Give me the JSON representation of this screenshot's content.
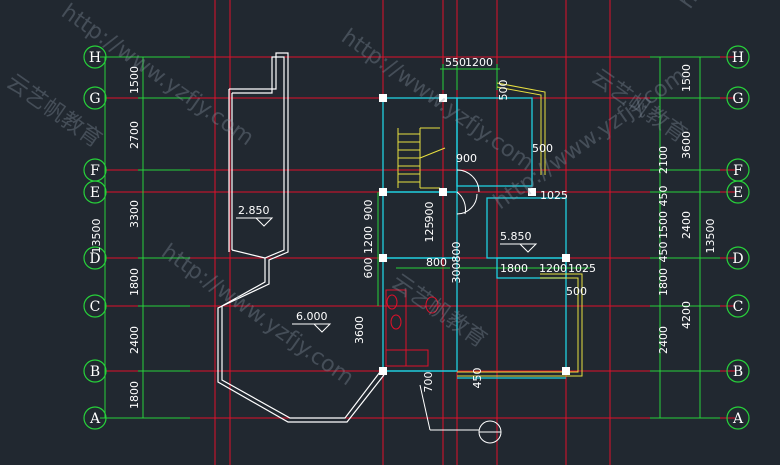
{
  "axes": [
    "H",
    "G",
    "F",
    "E",
    "D",
    "C",
    "B",
    "A"
  ],
  "left_dims": {
    "segments": [
      "1500",
      "2700",
      "3300",
      "1800",
      "2400",
      "1800"
    ],
    "total": "13500",
    "inner": [
      "900",
      "1200",
      "600"
    ]
  },
  "right_dims": {
    "outer": [
      "1500",
      "2100",
      "450",
      "1500",
      "450",
      "1800",
      "2400"
    ],
    "mid": [
      "3600",
      "2400",
      "4200"
    ],
    "total": "13500"
  },
  "top_dims": [
    "550",
    "1200"
  ],
  "inner_dims": [
    "500",
    "500",
    "900",
    "1025",
    "900",
    "125",
    "800",
    "300",
    "800",
    "1800",
    "1200",
    "1025",
    "500",
    "700",
    "450",
    "3600"
  ],
  "levels": [
    "2.850",
    "6.000",
    "5.850"
  ],
  "watermarks": [
    "http://www.yzfjy.com",
    "云艺帆教育"
  ]
}
